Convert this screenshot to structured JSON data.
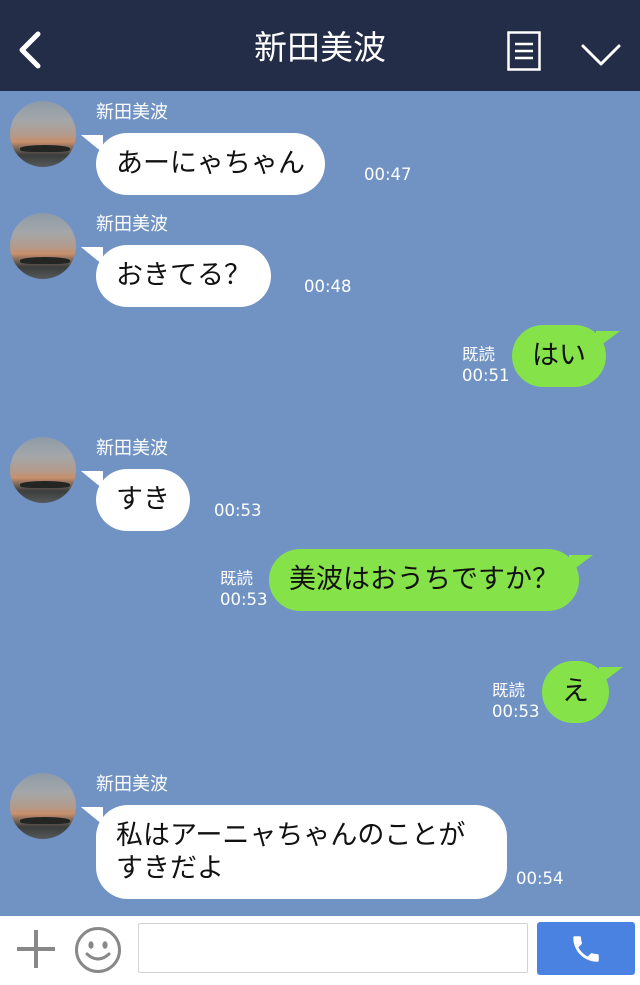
{
  "header": {
    "title": "新田美波"
  },
  "icons": {
    "back": "back-icon",
    "memo": "memo-icon",
    "menu": "chevron-down-icon",
    "add": "plus-icon",
    "sticker": "smiley-icon",
    "call": "phone-icon"
  },
  "messages": [
    {
      "side": "in",
      "sender": "新田美波",
      "text": "あーにゃちゃん",
      "time": "00:47"
    },
    {
      "side": "in",
      "sender": "新田美波",
      "text": "おきてる？",
      "time": "00:48"
    },
    {
      "side": "out",
      "read": "既読",
      "text": "はい",
      "time": "00:51"
    },
    {
      "side": "in",
      "sender": "新田美波",
      "text": "すき",
      "time": "00:53"
    },
    {
      "side": "out",
      "read": "既読",
      "text": "美波はおうちですか？",
      "time": "00:53"
    },
    {
      "side": "out",
      "read": "既読",
      "text": "え",
      "time": "00:53"
    },
    {
      "side": "in",
      "sender": "新田美波",
      "text": "私はアーニャちゃんのことがすきだよ",
      "time": "00:54"
    }
  ],
  "input": {
    "value": "",
    "placeholder": ""
  },
  "colors": {
    "header": "#232d47",
    "background": "#7093c4",
    "incoming_bubble": "#ffffff",
    "outgoing_bubble": "#85e249",
    "call_button": "#4a82e1"
  }
}
